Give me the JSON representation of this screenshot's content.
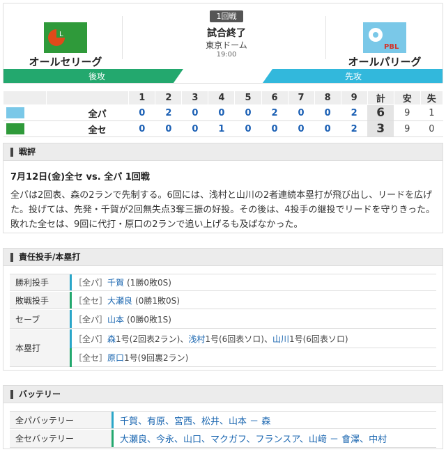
{
  "header": {
    "round": "1回戦",
    "status": "試合終了",
    "venue": "東京ドーム",
    "time": "19:00",
    "home_team": "オールセリーグ",
    "away_team": "オールパリーグ",
    "home_side": "後攻",
    "away_side": "先攻",
    "colors": {
      "home": "#23a86e",
      "away": "#32b8dc"
    }
  },
  "scoreboard": {
    "innings": [
      "1",
      "2",
      "3",
      "4",
      "5",
      "6",
      "7",
      "8",
      "9"
    ],
    "total_label": "計",
    "hits_label": "安",
    "errors_label": "失",
    "rows": [
      {
        "team": "全パ",
        "scores": [
          "0",
          "2",
          "0",
          "0",
          "0",
          "2",
          "0",
          "0",
          "2"
        ],
        "total": "6",
        "hits": "9",
        "errors": "1"
      },
      {
        "team": "全セ",
        "scores": [
          "0",
          "0",
          "0",
          "1",
          "0",
          "0",
          "0",
          "0",
          "2"
        ],
        "total": "3",
        "hits": "9",
        "errors": "0"
      }
    ]
  },
  "review": {
    "section_title": "戦評",
    "title": "7月12日(金)全セ vs. 全パ 1回戦",
    "text": "全パは2回表、森の2ランで先制する。6回には、浅村と山川の2者連続本塁打が飛び出し、リードを広げた。投げては、先発・千賀が2回無失点3奪三振の好投。その後は、4投手の継投でリードを守りきった。敗れた全セは、9回に代打・原口の2ランで追い上げるも及ばなかった。"
  },
  "pitchers": {
    "section_title": "責任投手/本塁打",
    "win": {
      "label": "勝利投手",
      "team": "［全パ］",
      "name": "千賀",
      "record": "(1勝0敗0S)"
    },
    "loss": {
      "label": "敗戦投手",
      "team": "［全セ］",
      "name": "大瀬良",
      "record": "(0勝1敗0S)"
    },
    "save": {
      "label": "セーブ",
      "team": "［全パ］",
      "name": "山本",
      "record": "(0勝0敗1S)"
    },
    "hr_label": "本塁打",
    "hr_pa": {
      "team": "［全パ］",
      "n1": "森",
      "d1": "1号(2回表2ラン)、",
      "n2": "浅村",
      "d2": "1号(6回表ソロ)、",
      "n3": "山川",
      "d3": "1号(6回表ソロ)"
    },
    "hr_ce": {
      "team": "［全セ］",
      "n1": "原口",
      "d1": "1号(9回裏2ラン)"
    }
  },
  "battery": {
    "section_title": "バッテリー",
    "pa_label": "全パバッテリー",
    "pa_value": "千賀、有原、宮西、松井、山本 － 森",
    "ce_label": "全セバッテリー",
    "ce_value": "大瀬良、今永、山口、マクガフ、フランスア、山﨑 － 會澤、中村"
  }
}
